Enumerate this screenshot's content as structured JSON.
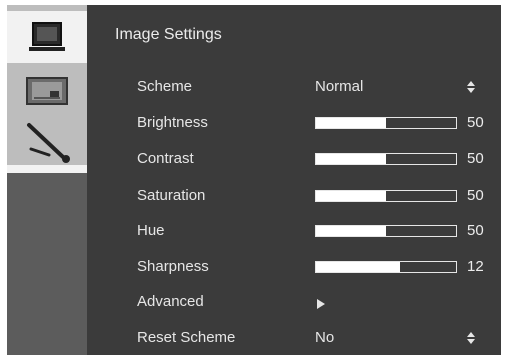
{
  "menu": {
    "title": "Image Settings",
    "tabs": [
      {
        "icon": "monitor-icon",
        "active": true
      },
      {
        "icon": "picture-frame-icon",
        "active": false
      },
      {
        "icon": "tools-icon",
        "active": false
      }
    ]
  },
  "rows": [
    {
      "label": "Scheme",
      "value": "Normal",
      "type": "spin"
    },
    {
      "label": "Brightness",
      "value": "50",
      "level": 0.5,
      "type": "slider"
    },
    {
      "label": "Contrast",
      "value": "50",
      "level": 0.5,
      "type": "slider"
    },
    {
      "label": "Saturation",
      "value": "50",
      "level": 0.5,
      "type": "slider"
    },
    {
      "label": "Hue",
      "value": "50",
      "level": 0.5,
      "type": "slider"
    },
    {
      "label": "Sharpness",
      "value": "12",
      "level": 0.6,
      "type": "slider"
    },
    {
      "label": "Advanced",
      "type": "submenu"
    },
    {
      "label": "Reset Scheme",
      "value": "No",
      "type": "spin"
    }
  ],
  "colors": {
    "panel": "#3b3b3b",
    "sidebar": "#5c5c5c",
    "active_tab": "#f2f2f2",
    "text": "#e6e6e6",
    "slider_fill": "#ffffff"
  }
}
